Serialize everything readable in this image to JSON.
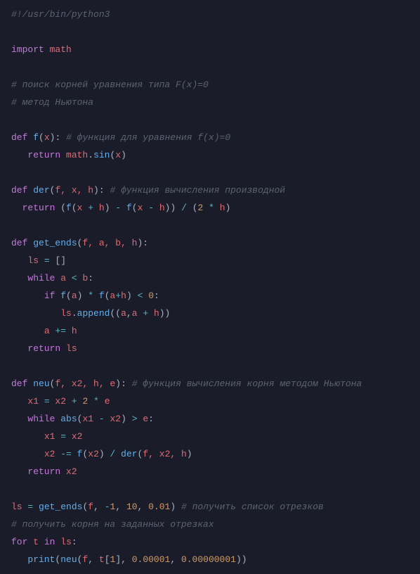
{
  "code": {
    "l01_shebang": "#!/usr/bin/python3",
    "l02_import": "import",
    "l02_math": "math",
    "l03_c1": "# поиск корней уравнения типа F(x)=0",
    "l04_c2": "# метод Ньютона",
    "l05_def": "def",
    "l05_fn": "f",
    "l05_arg": "x",
    "l05_c": "# функция для уравнения f(x)=0",
    "l06_ret": "return",
    "l06_math": "math",
    "l06_sin": "sin",
    "l06_x": "x",
    "l07_def": "def",
    "l07_fn": "der",
    "l07_args": "f, x, h",
    "l07_c": "# функция вычисления производной",
    "l08_ret": "return",
    "l08_f1": "f",
    "l08_x1": "x",
    "l08_plus": "+",
    "l08_h1": "h",
    "l08_minus": "-",
    "l08_f2": "f",
    "l08_x2": "x",
    "l08_minus2": "-",
    "l08_h2": "h",
    "l08_div": "/",
    "l08_two": "2",
    "l08_mul": "*",
    "l08_h3": "h",
    "l09_def": "def",
    "l09_fn": "get_ends",
    "l09_args": "f, a, b, h",
    "l10_ls": "ls",
    "l10_eq": "=",
    "l11_while": "while",
    "l11_a": "a",
    "l11_lt": "<",
    "l11_b": "b",
    "l12_if": "if",
    "l12_f1": "f",
    "l12_a1": "a",
    "l12_mul": "*",
    "l12_f2": "f",
    "l12_a2": "a",
    "l12_plus": "+",
    "l12_h": "h",
    "l12_lt": "<",
    "l12_zero": "0",
    "l13_ls": "ls",
    "l13_append": "append",
    "l13_a1": "a",
    "l13_a2": "a",
    "l13_plus": "+",
    "l13_h": "h",
    "l14_a": "a",
    "l14_pe": "+=",
    "l14_h": "h",
    "l15_ret": "return",
    "l15_ls": "ls",
    "l16_def": "def",
    "l16_fn": "neu",
    "l16_args": "f, x2, h, e",
    "l16_c": "# функция вычисления корня методом Ньютона",
    "l17_x1": "x1",
    "l17_eq": "=",
    "l17_x2": "x2",
    "l17_plus": "+",
    "l17_two": "2",
    "l17_mul": "*",
    "l17_e": "e",
    "l18_while": "while",
    "l18_abs": "abs",
    "l18_x1": "x1",
    "l18_minus": "-",
    "l18_x2": "x2",
    "l18_gt": ">",
    "l18_e": "e",
    "l19_x1": "x1",
    "l19_eq": "=",
    "l19_x2": "x2",
    "l20_x2": "x2",
    "l20_me": "-=",
    "l20_f": "f",
    "l20_x2a": "x2",
    "l20_div": "/",
    "l20_der": "der",
    "l20_args": "f, x2, h",
    "l21_ret": "return",
    "l21_x2": "x2",
    "l22_ls": "ls",
    "l22_eq": "=",
    "l22_ge": "get_ends",
    "l22_f": "f",
    "l22_m1": "-",
    "l22_n1": "1",
    "l22_n10": "10",
    "l22_n001": "0.01",
    "l22_c": "# получить список отрезков",
    "l23_c": "# получить корня на заданных отрезках",
    "l24_for": "for",
    "l24_t": "t",
    "l24_in": "in",
    "l24_ls": "ls",
    "l25_print": "print",
    "l25_neu": "neu",
    "l25_f": "f",
    "l25_t": "t",
    "l25_one": "1",
    "l25_n5": "0.00001",
    "l25_n8": "0.00000001"
  }
}
